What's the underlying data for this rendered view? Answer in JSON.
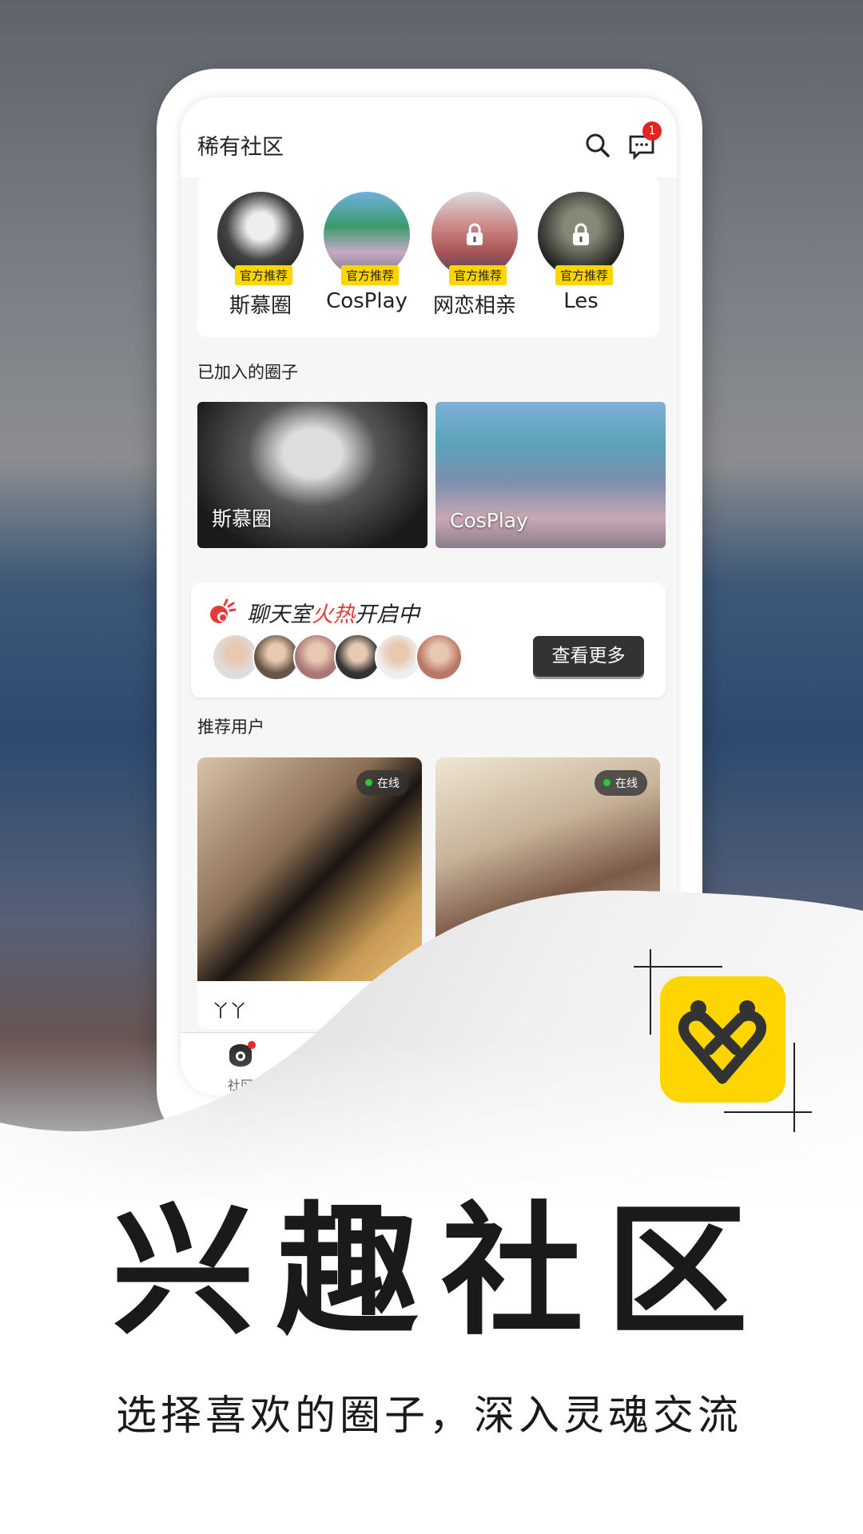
{
  "header": {
    "title": "稀有社区",
    "message_badge": "1"
  },
  "circles": [
    {
      "name": "斯慕圈",
      "badge": "官方推荐",
      "locked": false
    },
    {
      "name": "CosPlay",
      "badge": "官方推荐",
      "locked": false
    },
    {
      "name": "网恋相亲",
      "badge": "官方推荐",
      "locked": true
    },
    {
      "name": "Les",
      "badge": "官方推荐",
      "locked": true
    }
  ],
  "joined": {
    "title": "已加入的圈子",
    "items": [
      "斯慕圈",
      "CosPlay"
    ]
  },
  "chatroom": {
    "title_a": "聊天室",
    "title_hot": "火热",
    "title_b": "开启中",
    "button": "查看更多",
    "accent": "#e83a3a"
  },
  "recommended": {
    "title": "推荐用户",
    "users": [
      {
        "status": "在线",
        "name": "丫丫"
      },
      {
        "status": "在线",
        "name": ""
      }
    ]
  },
  "nav": {
    "items": [
      {
        "label": "社区",
        "active": true
      },
      {
        "label": "",
        "active": false
      }
    ]
  },
  "promo": {
    "headline": "兴趣社区",
    "subtitle": "选择喜欢的圈子，深入灵魂交流",
    "brand_color": "#ffd500"
  }
}
